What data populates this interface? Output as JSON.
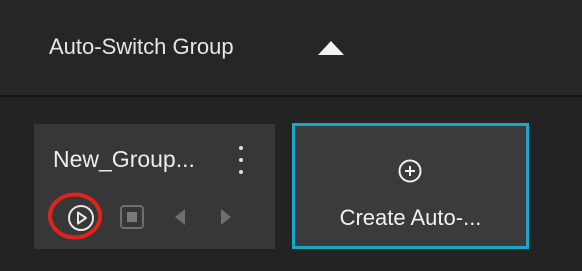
{
  "header": {
    "title": "Auto-Switch Group",
    "toggle_icon": "caret-up-icon"
  },
  "group_card": {
    "name": "New_Group...",
    "controls": [
      "play-icon",
      "stop-icon",
      "previous-icon",
      "next-icon"
    ]
  },
  "create_card": {
    "label": "Create Auto-...",
    "icon": "add-circle-icon"
  },
  "colors": {
    "accent_border": "#18a9c6",
    "highlight_ring": "#e0231b",
    "card_bg": "#373737",
    "header_bg": "#262626"
  }
}
